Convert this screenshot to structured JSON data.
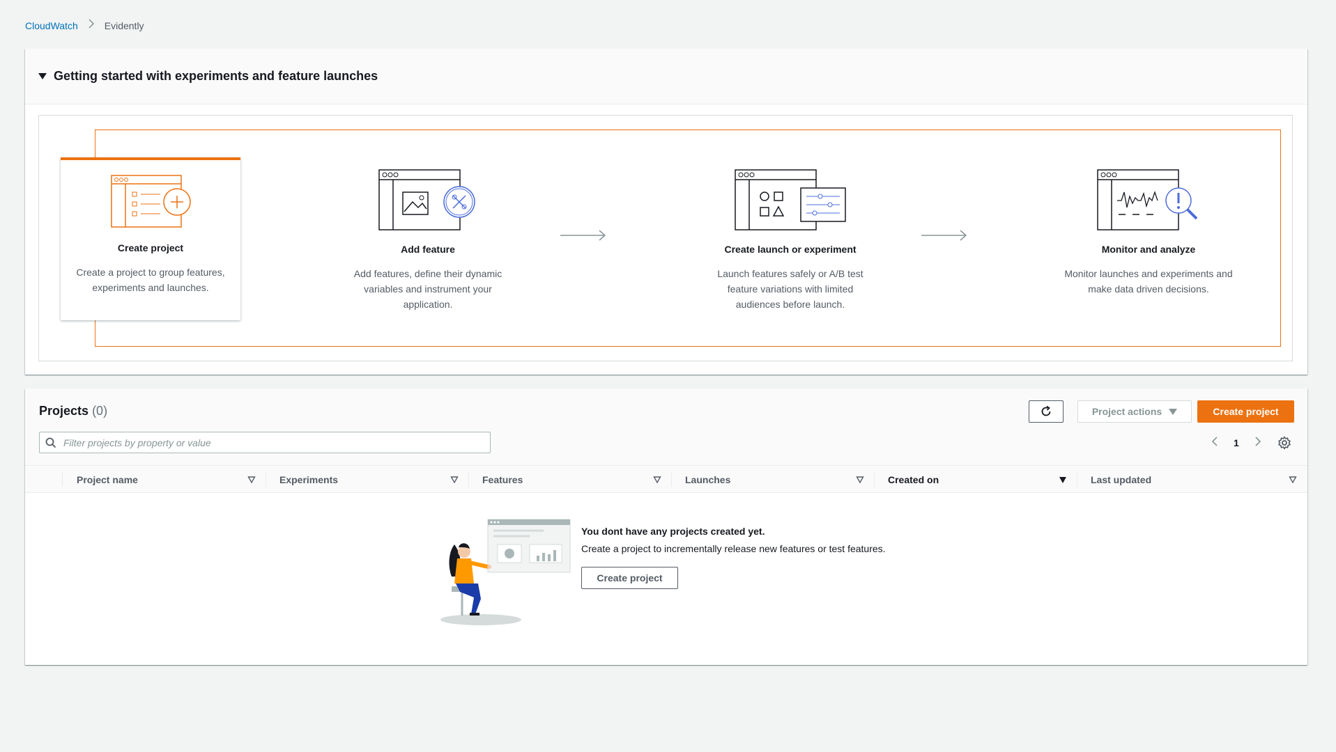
{
  "breadcrumb": {
    "items": [
      "CloudWatch",
      "Evidently"
    ]
  },
  "getting_started": {
    "title": "Getting started with experiments and feature launches",
    "steps": [
      {
        "icon": "create-project-icon",
        "title": "Create project",
        "desc_lines": [
          "Create a project to group features,",
          "experiments and launches."
        ]
      },
      {
        "icon": "add-feature-icon",
        "title": "Add feature",
        "desc_lines": [
          "Add features, define their dynamic",
          "variables and instrument your",
          "application."
        ]
      },
      {
        "icon": "launch-experiment-icon",
        "title": "Create launch or experiment",
        "desc_lines": [
          "Launch features safely or A/B test",
          "feature variations with limited",
          "audiences before launch."
        ]
      },
      {
        "icon": "monitor-analyze-icon",
        "title": "Monitor and analyze",
        "desc_lines": [
          "Monitor launches and experiments and",
          "make data driven decisions."
        ]
      }
    ]
  },
  "projects": {
    "title": "Projects",
    "count": "(0)",
    "actions_label": "Project actions",
    "create_label": "Create project",
    "search_placeholder": "Filter projects by property or value",
    "page": "1",
    "columns": [
      "Project name",
      "Experiments",
      "Features",
      "Launches",
      "Created on",
      "Last updated"
    ],
    "active_sort_column": "Created on",
    "empty": {
      "title": "You dont have any projects created yet.",
      "desc": "Create a project to incrementally release new features or test features.",
      "button": "Create project"
    }
  },
  "colors": {
    "accent": "#ec7211",
    "link": "#0073bb",
    "background": "#f2f3f3",
    "icon_blue": "#4b6cdb"
  }
}
